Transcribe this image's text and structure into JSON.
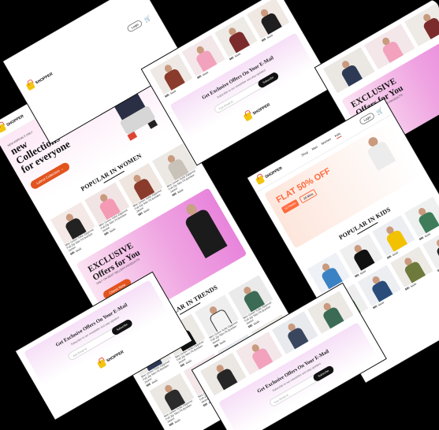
{
  "brand": {
    "name": "SHOPPER"
  },
  "nav": {
    "items": [
      "Shop",
      "Men",
      "Women",
      "Kids"
    ],
    "active": "Shop"
  },
  "header": {
    "login_label": "Login",
    "cart_icon": "cart-icon"
  },
  "hero": {
    "tag": "NEW ARRIVALS ONLY",
    "line1": "new",
    "line2": "Collections",
    "line3": "for everyone",
    "cta": "Latest Collection →"
  },
  "popular_women": {
    "title": "POPULAR IN WOMEN"
  },
  "popular_trends": {
    "title": "POPULAR IN TRENDS"
  },
  "popular_kids": {
    "title": "POPULAR IN KIDS"
  },
  "exclusive": {
    "line1": "EXCLUSIVE",
    "line2": "Offers for You",
    "sub": "ONLY ON BEST SELLERS PRODUCTS",
    "cta": "Check Now"
  },
  "newsletter": {
    "title": "Get Exclusive Offers On Your E-Mail",
    "sub": "Subscribe to our newsletter and stay updated",
    "placeholder": "Your Email id",
    "button": "Subscribe"
  },
  "kids_banner": {
    "flat": "FLAT 50% OFF",
    "hours": "12 Hours",
    "mins": "20 Mins"
  },
  "product": {
    "name": "Men Green Solid Zippered Full-Zip Slim Fit Bomber Jacket",
    "price_new": "$85",
    "price_old": "$120"
  },
  "colors": {
    "accent": "#e2541e",
    "pink": "#e884dc",
    "black": "#111111"
  }
}
